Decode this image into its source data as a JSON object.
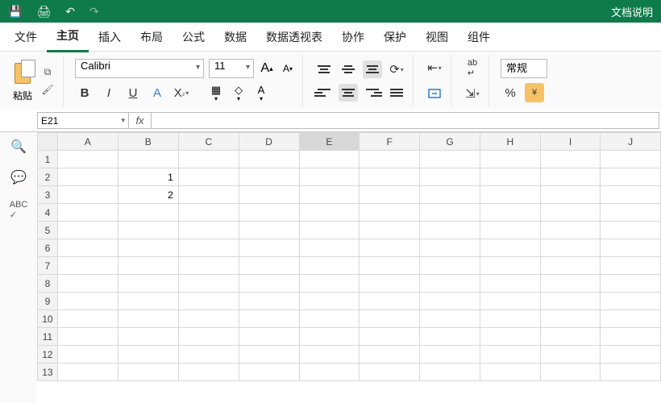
{
  "titlebar": {
    "doc_label": "文档说明"
  },
  "menu": {
    "tabs": [
      "文件",
      "主页",
      "插入",
      "布局",
      "公式",
      "数据",
      "数据透视表",
      "协作",
      "保护",
      "视图",
      "组件"
    ],
    "active": 1
  },
  "ribbon": {
    "paste_label": "粘贴",
    "font_name": "Calibri",
    "font_size": "11",
    "number_format": "常规",
    "font_color": "#c0392b",
    "fill_color": "#f1c40f",
    "border_color": "#333"
  },
  "namebox": {
    "value": "E21"
  },
  "formula": {
    "value": ""
  },
  "sheet": {
    "columns": [
      "A",
      "B",
      "C",
      "D",
      "E",
      "F",
      "G",
      "H",
      "I",
      "J"
    ],
    "selected_col": "E",
    "rows": 13,
    "cells": {
      "B2": "1",
      "B3": "2"
    }
  },
  "sidebar_tools": [
    "search",
    "comment",
    "abc"
  ]
}
